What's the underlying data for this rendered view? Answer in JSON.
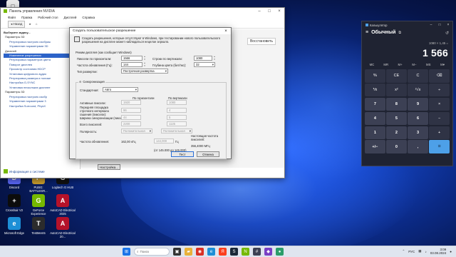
{
  "nvidia": {
    "title": "Панель управления NVIDIA",
    "menu": [
      "Файл",
      "Правка",
      "Рабочий стол",
      "Дисплей",
      "Справка"
    ],
    "toolbar": {
      "back": "Назад",
      "home_icon": "home-icon"
    },
    "tree": [
      {
        "text": "Выберите задачу...",
        "kind": "head"
      },
      {
        "text": "Параметры 3D",
        "kind": "cat"
      },
      {
        "text": "Регулировка настроек изображ",
        "kind": "item"
      },
      {
        "text": "Управление параметрами 3D",
        "kind": "item"
      },
      {
        "text": "Дисплей",
        "kind": "cat"
      },
      {
        "text": "Изменение разрешения",
        "kind": "sel"
      },
      {
        "text": "Регулировка параметров цвета",
        "kind": "item"
      },
      {
        "text": "Поворот дисплея",
        "kind": "item"
      },
      {
        "text": "Просмотр состояния HDCP",
        "kind": "item"
      },
      {
        "text": "Установка цифрового аудио",
        "kind": "item"
      },
      {
        "text": "Регулировка размера и положе",
        "kind": "item"
      },
      {
        "text": "Настройка G-SYNC",
        "kind": "item"
      },
      {
        "text": "Установка нескольких дисплее",
        "kind": "item"
      },
      {
        "text": "Параметры 3D",
        "kind": "cat"
      },
      {
        "text": "Регулировка настроек изобр",
        "kind": "item"
      },
      {
        "text": "Управление параметрами 3",
        "kind": "item"
      },
      {
        "text": "Настройка Surround, PhysX",
        "kind": "item"
      }
    ],
    "restore": "Восстановить",
    "sysinfo": "Информация о системе",
    "bottom_button": "Настройка..."
  },
  "dialog": {
    "title": "Создать пользовательское разрешение",
    "warning": "Создать разрешения, которые отсутствуют в Windows, при тестировании нового пользовательского разрешения на дисплее может наблюдаться нецелое зеркало.",
    "mode_label": "Режим дисплея (как сообщает Windows)",
    "h_pixels_label": "Пиксели по горизонтали:",
    "h_pixels": "1566",
    "v_lines_label": "Строки по вертикали:",
    "v_lines": "1080",
    "refresh_label": "Частота обновления (Гц):",
    "refresh": "144",
    "color_depth_label": "Глубина цвета (бит/пкс):",
    "color_depth": "32",
    "scan_label": "Тип развертки:",
    "scan": "Построчная развертка",
    "sync_title": "Синхронизация",
    "standard_label": "Стандартная:",
    "standard": "Авто",
    "col_h": "По горизонтали",
    "col_v": "По вертикали",
    "active_label": "Активные пиксели:",
    "active_h": "1920",
    "active_v": "1080",
    "front_label": "Передняя площадка строчного интервала гашения (пиксели):",
    "front_h": "96",
    "front_v": "4",
    "sync_w_label": "Ширина синхронизации (пиксели):",
    "sync_w_h": "44",
    "sync_w_v": "5",
    "total_label": "Всего пикселей:",
    "total_h": "2200",
    "total_v": "1125",
    "polarity_label": "Полярность:",
    "polarity_h": "Положительная",
    "polarity_v": "Положительная",
    "refresh_rate_label": "Частота обновления:",
    "refresh_rate": "162,00 кГц",
    "refresh_hz": "144,000",
    "hz_unit": "Гц",
    "pixel_clock_label": "Настоящая частота пикселей:",
    "pixel_clock": "356,4000 МГц",
    "total_note": "(от 145.000 до 145.000)",
    "test_button": "Тест",
    "cancel_button": "Отмена"
  },
  "calculator": {
    "title": "Калькулятор",
    "mode": "Обычный",
    "expression": "1080 × 1,45 =",
    "display": "1 566",
    "memory": [
      "MC",
      "MR",
      "M+",
      "M−",
      "MS",
      "M▾"
    ],
    "keys": [
      "%",
      "CE",
      "C",
      "⌫",
      "⅟x",
      "x²",
      "²√x",
      "÷",
      "7",
      "8",
      "9",
      "×",
      "4",
      "5",
      "6",
      "−",
      "1",
      "2",
      "3",
      "+",
      "+/−",
      "0",
      ",",
      "="
    ]
  },
  "desktop": {
    "icons": [
      {
        "label": "Discord",
        "color": "#5865f2",
        "glyph": "D"
      },
      {
        "label": "PUBG: BATTLEGR...",
        "color": "#c49a2c",
        "glyph": "P"
      },
      {
        "label": "Logitech G HUB",
        "color": "#111111",
        "glyph": "G"
      },
      {
        "label": "Crosshair V2",
        "color": "#0c0c0c",
        "glyph": "+"
      },
      {
        "label": "GeForce Experience",
        "color": "#76b900",
        "glyph": "G"
      },
      {
        "label": "AutoCAD Electrical 2025",
        "color": "#b5122a",
        "glyph": "A"
      },
      {
        "label": "Microsoft Edge",
        "color": "#1d8fd6",
        "glyph": "e"
      },
      {
        "label": "TestMem5",
        "color": "#2c2c2c",
        "glyph": "T"
      },
      {
        "label": "AutoCAD Electrical 20...",
        "color": "#b5122a",
        "glyph": "A"
      }
    ]
  },
  "taskbar": {
    "search": "Поиск",
    "lang": "РУС",
    "time": "3:09",
    "date": "03.08.2024"
  }
}
